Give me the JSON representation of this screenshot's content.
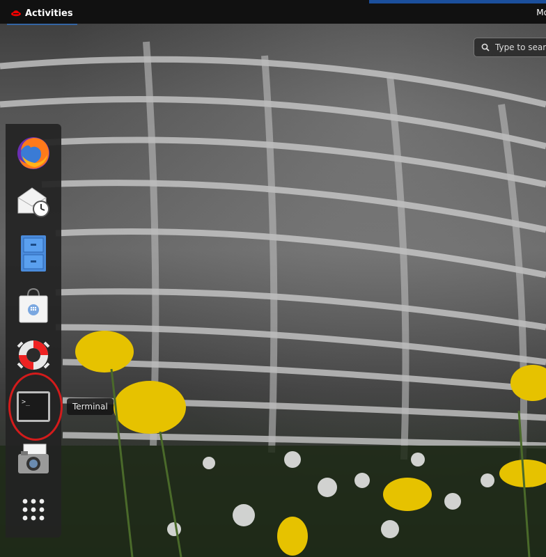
{
  "topbar": {
    "activities_label": "Activities",
    "right_menu_label": "Mo"
  },
  "search": {
    "placeholder": "Type to searc"
  },
  "dash": {
    "apps": [
      {
        "name": "Firefox",
        "icon": "firefox-icon"
      },
      {
        "name": "Evolution",
        "icon": "mail-clock-icon"
      },
      {
        "name": "Files",
        "icon": "file-cabinet-icon"
      },
      {
        "name": "Software",
        "icon": "shopping-bag-icon"
      },
      {
        "name": "Help",
        "icon": "lifebuoy-icon"
      },
      {
        "name": "Terminal",
        "icon": "terminal-icon"
      },
      {
        "name": "Cheese",
        "icon": "camera-icon"
      },
      {
        "name": "Show Applications",
        "icon": "app-grid-icon"
      }
    ],
    "tooltip": "Terminal"
  },
  "colors": {
    "accent": "#3465a4",
    "highlight": "#d31b1b",
    "panel": "#111111"
  }
}
